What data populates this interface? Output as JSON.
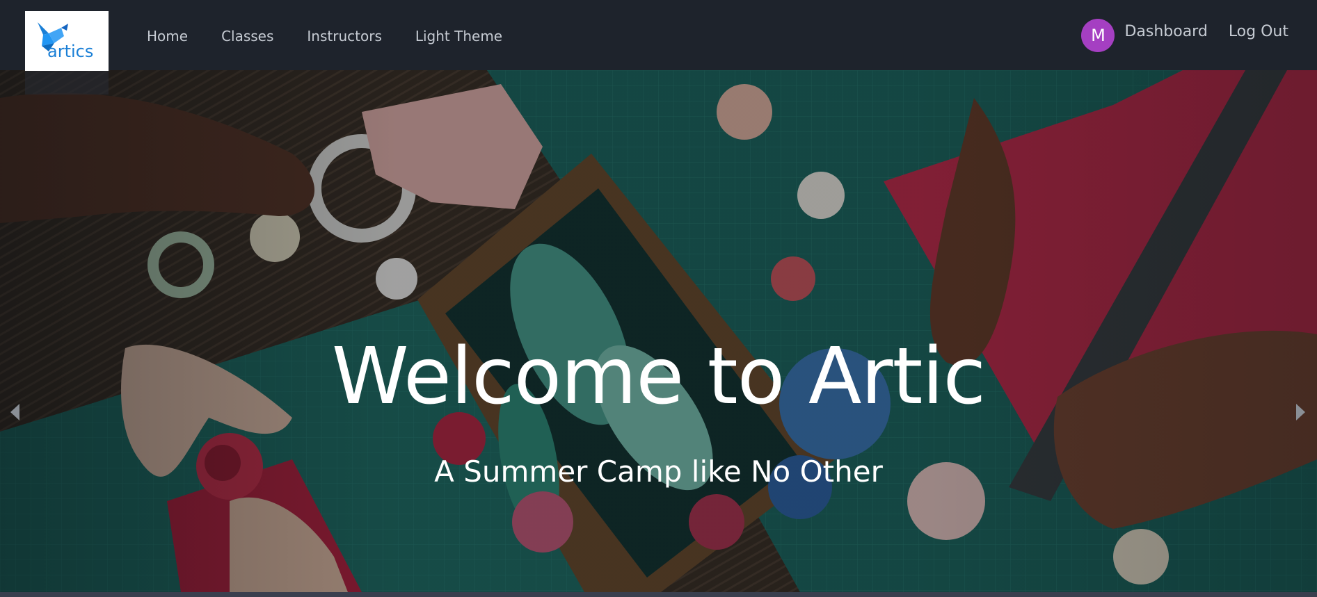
{
  "brand": {
    "logo_text": "artics",
    "logo_color": "#1a7fd6"
  },
  "nav": {
    "items": [
      {
        "label": "Home"
      },
      {
        "label": "Classes"
      },
      {
        "label": "Instructors"
      },
      {
        "label": "Light Theme"
      }
    ]
  },
  "user": {
    "avatar_letter": "M",
    "avatar_color": "#a53fc2",
    "dashboard_label": "Dashboard",
    "logout_label": "Log Out"
  },
  "hero": {
    "title": "Welcome to Artic",
    "subtitle": "A Summer Camp like No Other"
  },
  "colors": {
    "navbar_bg": "#1e232c",
    "nav_text": "#c6cbd3"
  },
  "icons": {
    "logo": "origami-bird-icon",
    "carousel_prev": "caret-left-icon",
    "carousel_next": "caret-right-icon"
  }
}
